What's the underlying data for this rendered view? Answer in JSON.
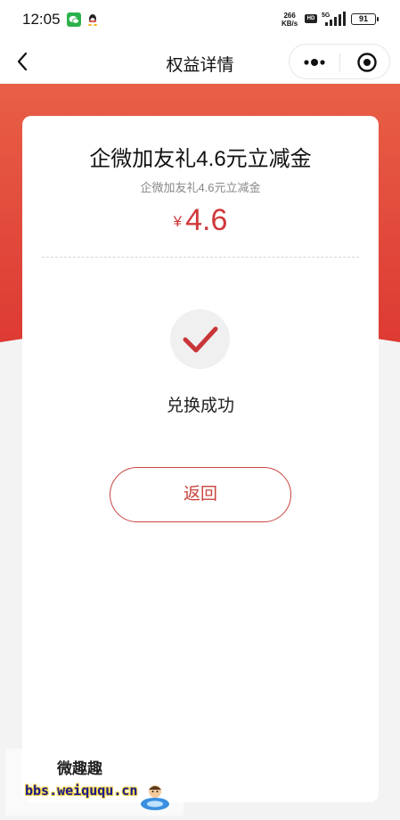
{
  "status_bar": {
    "time": "12:05",
    "net_speed_value": "266",
    "net_speed_unit": "KB/s",
    "hd_label": "HD",
    "network": "5G",
    "battery": "91"
  },
  "navbar": {
    "title": "权益详情",
    "back_icon": "chevron-left-icon",
    "more_icon": "more-dots-icon",
    "close_icon": "target-close-icon"
  },
  "card": {
    "title": "企微加友礼4.6元立减金",
    "subtitle": "企微加友礼4.6元立减金",
    "currency": "¥",
    "amount": "4.6",
    "status_text": "兑换成功",
    "back_button_label": "返回"
  },
  "watermark": {
    "name": "微趣趣",
    "url": "bbs.weiququ.cn"
  },
  "colors": {
    "accent_red": "#d1383a",
    "header_red": "#e04a3a"
  }
}
